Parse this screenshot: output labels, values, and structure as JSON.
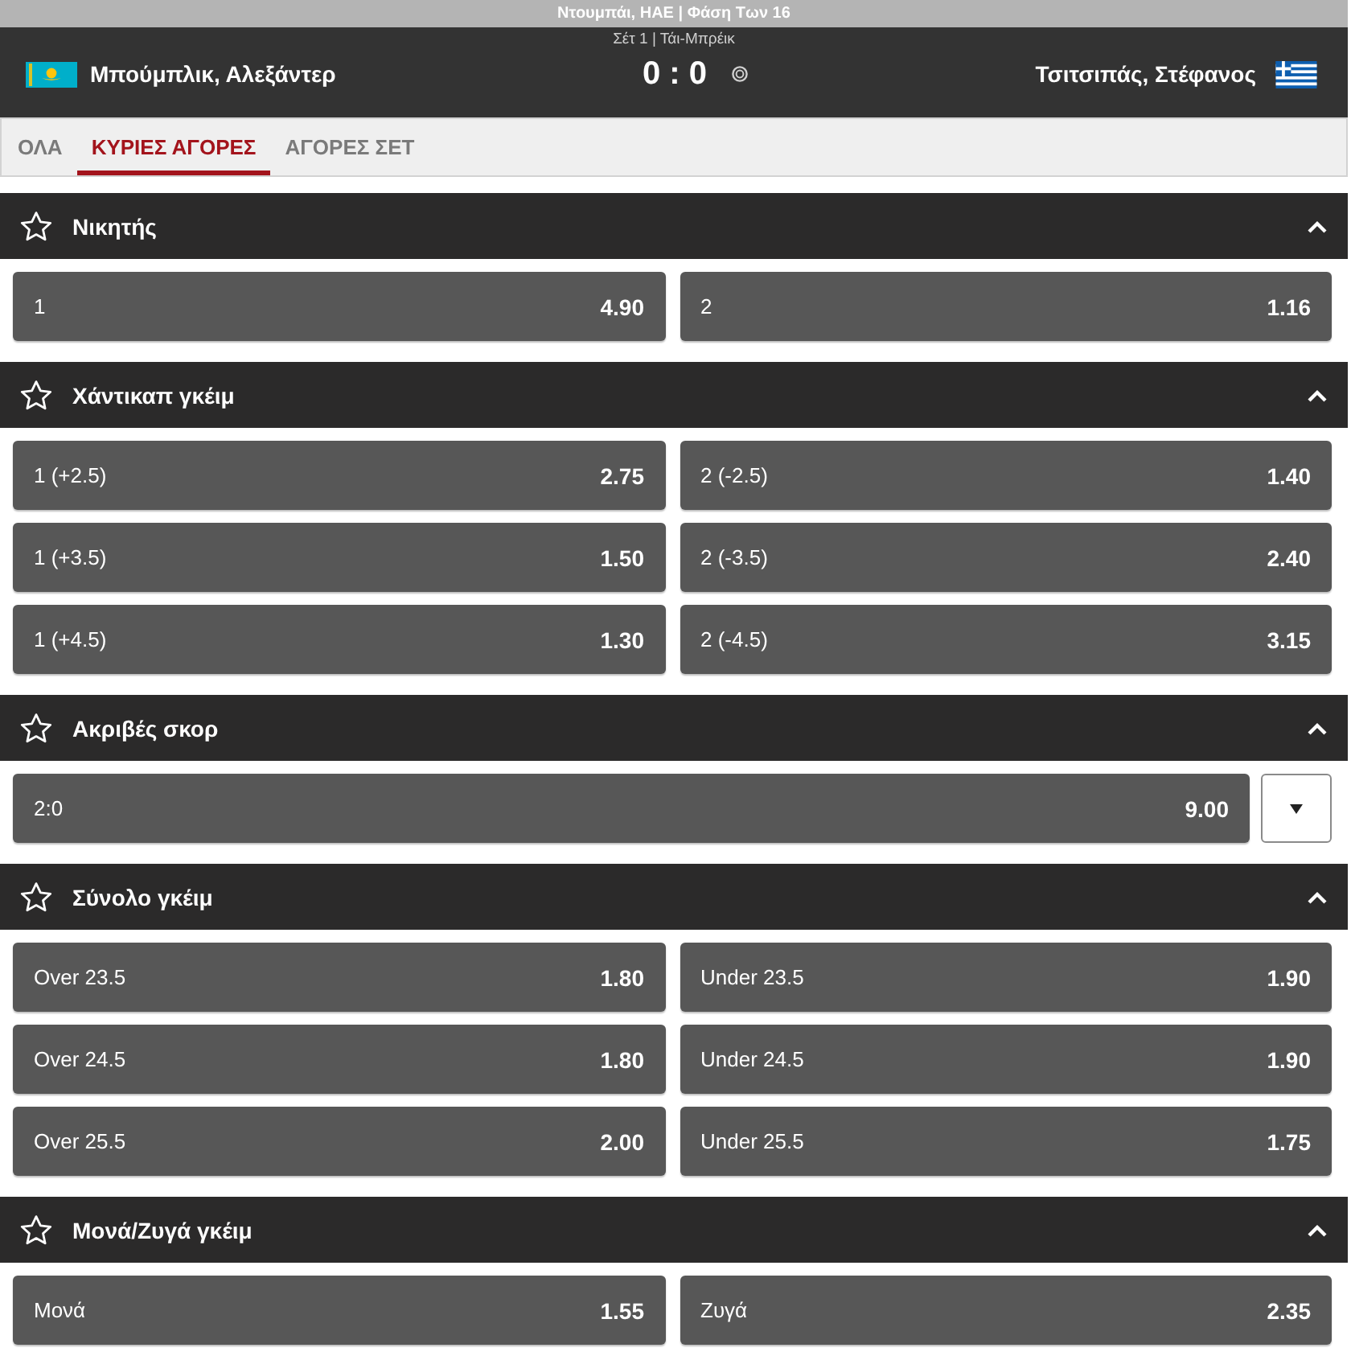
{
  "info_bar": {
    "text": "Ντουμπάι, ΗΑΕ | Φάση Των 16"
  },
  "match": {
    "status": "Σέτ 1 | Τάι-Μπρέικ",
    "home": "Μπούμπλικ, Αλεξάντερ",
    "score": "0 : 0",
    "away": "Τσιτσιπάς, Στέφανος"
  },
  "tabs": [
    {
      "label": "ΟΛΑ",
      "selected": false
    },
    {
      "label": "ΚΥΡΙΕΣ ΑΓΟΡΕΣ",
      "selected": true
    },
    {
      "label": "ΑΓΟΡΕΣ ΣΕΤ",
      "selected": false
    }
  ],
  "markets": [
    {
      "title": "Νικητής",
      "expanded": true,
      "kind": "grid",
      "selections": [
        {
          "label": "1",
          "odds": "4.90"
        },
        {
          "label": "2",
          "odds": "1.16"
        }
      ]
    },
    {
      "title": "Χάντικαπ γκέιμ",
      "expanded": true,
      "kind": "grid",
      "selections": [
        {
          "label": "1 (+2.5)",
          "odds": "2.75"
        },
        {
          "label": "2 (-2.5)",
          "odds": "1.40"
        },
        {
          "label": "1 (+3.5)",
          "odds": "1.50"
        },
        {
          "label": "2 (-3.5)",
          "odds": "2.40"
        },
        {
          "label": "1 (+4.5)",
          "odds": "1.30"
        },
        {
          "label": "2 (-4.5)",
          "odds": "3.15"
        }
      ]
    },
    {
      "title": "Ακριβές σκορ",
      "expanded": true,
      "kind": "picker",
      "selections": [
        {
          "label": "2:0",
          "odds": "9.00"
        }
      ]
    },
    {
      "title": "Σύνολο γκέιμ",
      "expanded": true,
      "kind": "grid",
      "selections": [
        {
          "label": "Over 23.5",
          "odds": "1.80"
        },
        {
          "label": "Under 23.5",
          "odds": "1.90"
        },
        {
          "label": "Over 24.5",
          "odds": "1.80"
        },
        {
          "label": "Under 24.5",
          "odds": "1.90"
        },
        {
          "label": "Over 25.5",
          "odds": "2.00"
        },
        {
          "label": "Under 25.5",
          "odds": "1.75"
        }
      ]
    },
    {
      "title": "Μονά/Ζυγά γκέιμ",
      "expanded": true,
      "kind": "grid",
      "selections": [
        {
          "label": "Μονά",
          "odds": "1.55"
        },
        {
          "label": "Ζυγά",
          "odds": "2.35"
        }
      ]
    }
  ]
}
